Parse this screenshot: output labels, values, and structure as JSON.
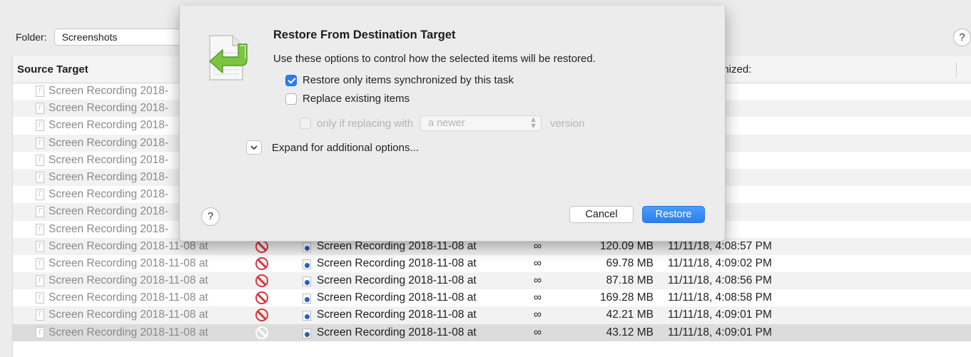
{
  "folder": {
    "label": "Folder:",
    "value": "Screenshots"
  },
  "help_label": "?",
  "table": {
    "header_source": "Source Target",
    "header_sync": "ronized:",
    "rows": [
      {
        "source": "Screen Recording 2018-",
        "dest": "",
        "infinity": "",
        "size": "",
        "date": ":08:55 PM",
        "blocked": false
      },
      {
        "source": "Screen Recording 2018-",
        "dest": "",
        "infinity": "",
        "size": "",
        "date": ":09:03 PM",
        "blocked": false
      },
      {
        "source": "Screen Recording 2018-",
        "dest": "",
        "infinity": "",
        "size": "",
        "date": ":08:55 PM",
        "blocked": false
      },
      {
        "source": "Screen Recording 2018-",
        "dest": "",
        "infinity": "",
        "size": "",
        "date": ":09:00 PM",
        "blocked": false
      },
      {
        "source": "Screen Recording 2018-",
        "dest": "",
        "infinity": "",
        "size": "",
        "date": ":09:00 PM",
        "blocked": false
      },
      {
        "source": "Screen Recording 2018-",
        "dest": "",
        "infinity": "",
        "size": "",
        "date": ":09:04 PM",
        "blocked": false
      },
      {
        "source": "Screen Recording 2018-",
        "dest": "",
        "infinity": "",
        "size": "",
        "date": ":08:54 PM",
        "blocked": false
      },
      {
        "source": "Screen Recording 2018-",
        "dest": "",
        "infinity": "",
        "size": "",
        "date": ":08:59 PM",
        "blocked": false
      },
      {
        "source": "Screen Recording 2018-",
        "dest": "",
        "infinity": "",
        "size": "",
        "date": ":08:54 PM",
        "blocked": false
      },
      {
        "source": "Screen Recording 2018-11-08 at",
        "dest": "Screen Recording 2018-11-08 at",
        "infinity": "∞",
        "size": "120.09 MB",
        "date": "11/11/18, 4:08:57 PM",
        "blocked": true
      },
      {
        "source": "Screen Recording 2018-11-08 at",
        "dest": "Screen Recording 2018-11-08 at",
        "infinity": "∞",
        "size": "69.78 MB",
        "date": "11/11/18, 4:09:02 PM",
        "blocked": true
      },
      {
        "source": "Screen Recording 2018-11-08 at",
        "dest": "Screen Recording 2018-11-08 at",
        "infinity": "∞",
        "size": "87.18 MB",
        "date": "11/11/18, 4:08:56 PM",
        "blocked": true
      },
      {
        "source": "Screen Recording 2018-11-08 at",
        "dest": "Screen Recording 2018-11-08 at",
        "infinity": "∞",
        "size": "169.28 MB",
        "date": "11/11/18, 4:08:58 PM",
        "blocked": true
      },
      {
        "source": "Screen Recording 2018-11-08 at",
        "dest": "Screen Recording 2018-11-08 at",
        "infinity": "∞",
        "size": "42.21 MB",
        "date": "11/11/18, 4:09:01 PM",
        "blocked": true
      },
      {
        "source": "Screen Recording 2018-11-08 at",
        "dest": "Screen Recording 2018-11-08 at",
        "infinity": "∞",
        "size": "43.12 MB",
        "date": "11/11/18, 4:09:01 PM",
        "blocked": true,
        "selected": true
      }
    ]
  },
  "dialog": {
    "title": "Restore From Destination Target",
    "description": "Use these options to control how the selected items will be restored.",
    "restore_only_label": "Restore only items synchronized by this task",
    "restore_only_checked": true,
    "replace_label": "Replace existing items",
    "replace_checked": false,
    "only_if_label": "only if replacing with",
    "newer_option": "a newer",
    "version_label": "version",
    "expand_label": "Expand for additional options...",
    "help_label": "?",
    "cancel_label": "Cancel",
    "restore_label": "Restore"
  },
  "colors": {
    "accent": "#2b7cf0",
    "blocked": "#d9363e"
  }
}
